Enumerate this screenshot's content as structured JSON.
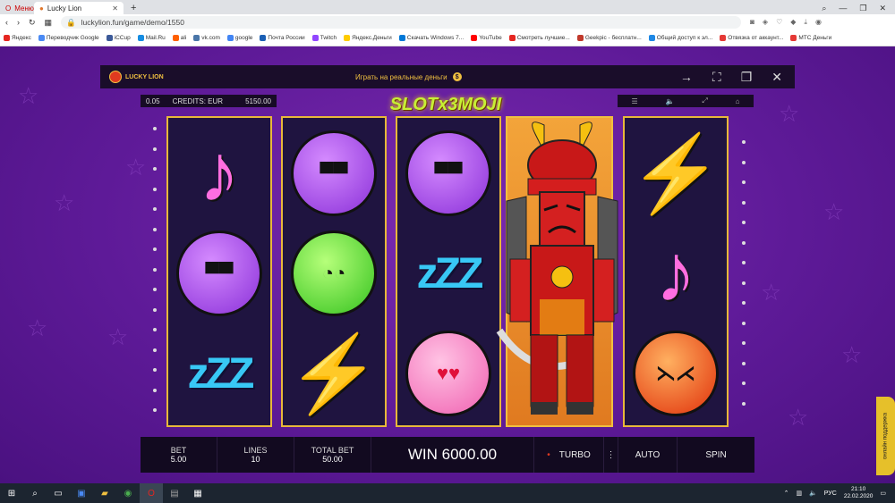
{
  "browser": {
    "menu_label": "Меню",
    "tab_title": "Lucky Lion",
    "url": "luckylion.fun/game/demo/1550",
    "bookmarks": [
      "Яндекс",
      "Переводчик Google",
      "iCCup",
      "Mail.Ru",
      "ali",
      "vk.com",
      "google",
      "Почта России",
      "Twitch",
      "Яндекс.Деньги",
      "Скачать Windows 7...",
      "YouTube",
      "Смотреть лучшие...",
      "Geekpic - бесплатн...",
      "Общий доступ к эл...",
      "Отвязка от аккаунт...",
      "МТС Деньги"
    ],
    "bookmark_colors": [
      "#e52620",
      "#4a8af4",
      "#3b5998",
      "#168de2",
      "#ff6000",
      "#4a76a8",
      "#4285f4",
      "#1a5fb4",
      "#9146ff",
      "#ffcc00",
      "#0078d7",
      "#ff0000",
      "#e52620",
      "#c0392b",
      "#1e88e5",
      "#e53935",
      "#e53935"
    ]
  },
  "game": {
    "logo_text": "LUCKY LION",
    "real_money_label": "Играть на реальные деньги",
    "coin_symbol": "$",
    "title": "SLOTx3MOJI",
    "bet_per_line": "0.05",
    "credits_label": "CREDITS: EUR",
    "credits_amount": "5150.00",
    "bet_label": "BET",
    "bet_value": "5.00",
    "lines_label": "LINES",
    "lines_value": "10",
    "total_bet_label": "TOTAL BET",
    "total_bet_value": "50.00",
    "win_text": "WIN 6000.00",
    "turbo_label": "TURBO",
    "auto_label": "AUTO",
    "spin_label": "SPIN",
    "chat_label": "онлайн поддержка"
  },
  "reels": [
    [
      "music-note",
      "purple-sunglasses-face",
      "zzz"
    ],
    [
      "purple-sunglasses-face",
      "green-sick-face",
      "lightning-bolt"
    ],
    [
      "purple-sunglasses-face",
      "zzz",
      "pink-heart-eyes-face"
    ],
    [
      "samurai-wild"
    ],
    [
      "lightning-bolt",
      "music-note",
      "red-angry-face"
    ]
  ],
  "taskbar": {
    "lang": "РУС",
    "time": "21:10",
    "date": "22.02.2020"
  }
}
